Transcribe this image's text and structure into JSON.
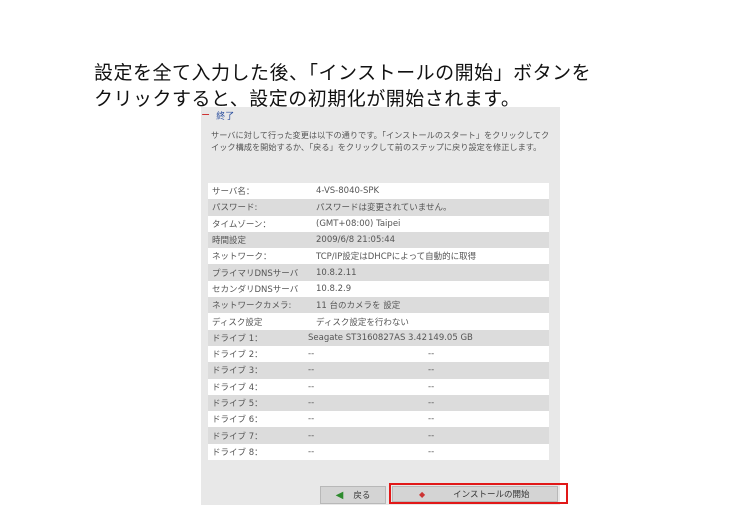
{
  "caption": {
    "line1": "設定を全て入力した後、「インストールの開始」ボタンを",
    "line2": "クリックすると、設定の初期化が開始されます。"
  },
  "section": {
    "collapse_glyph": "−",
    "title": "終了",
    "description": "サーバに対して行った変更は以下の通りです。「インストールのスタート」をクリックしてクイック構成を開始するか、「戻る」をクリックして前のステップに戻り設定を修正します。"
  },
  "summary": [
    {
      "label": "サーバ名：",
      "value": "4-VS-8040-SPK"
    },
    {
      "label": "パスワード:",
      "value": "パスワードは変更されていません。"
    },
    {
      "label": "タイムゾーン：",
      "value": "(GMT+08:00) Taipei"
    },
    {
      "label": "時間設定",
      "value": "2009/6/8 21:05:44"
    },
    {
      "label": "ネットワーク：",
      "value": "TCP/IP設定はDHCPによって自動的に取得"
    },
    {
      "label": "プライマリDNSサーバ",
      "value": "10.8.2.11"
    },
    {
      "label": "セカンダリDNSサーバ",
      "value": "10.8.2.9"
    },
    {
      "label": "ネットワークカメラ:",
      "value": "11 台のカメラを 設定"
    },
    {
      "label": "ディスク設定",
      "value": "ディスク設定を行わない"
    }
  ],
  "drives": [
    {
      "label": "ドライブ 1：",
      "model": "Seagate ST3160827AS 3.42",
      "size": "149.05 GB"
    },
    {
      "label": "ドライブ 2：",
      "model": "--",
      "size": "--"
    },
    {
      "label": "ドライブ 3：",
      "model": "--",
      "size": "--"
    },
    {
      "label": "ドライブ 4：",
      "model": "--",
      "size": "--"
    },
    {
      "label": "ドライブ 5：",
      "model": "--",
      "size": "--"
    },
    {
      "label": "ドライブ 6：",
      "model": "--",
      "size": "--"
    },
    {
      "label": "ドライブ 7：",
      "model": "--",
      "size": "--"
    },
    {
      "label": "ドライブ 8：",
      "model": "--",
      "size": "--"
    }
  ],
  "buttons": {
    "back_label": "戻る",
    "back_icon": "arrow-left-icon",
    "install_label": "インストールの開始",
    "install_icon": "install-dot-icon"
  },
  "colors": {
    "highlight": "#e11818",
    "section_title": "#2b4f9e",
    "panel_bg": "#e8e8e8"
  }
}
